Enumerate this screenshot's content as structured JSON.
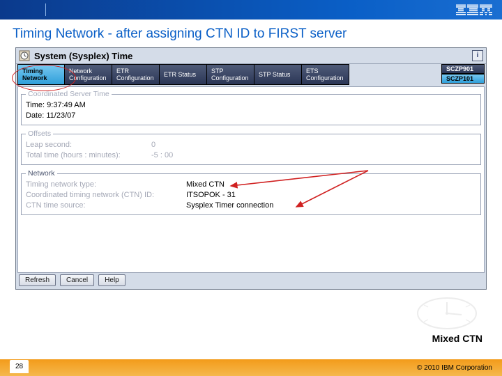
{
  "slide": {
    "title": "Timing Network - after assigning CTN ID to FIRST server",
    "caption": "Mixed CTN",
    "page_number": "28",
    "copyright": "© 2010 IBM Corporation"
  },
  "window": {
    "title": "System (Sysplex) Time",
    "help": "i"
  },
  "tabs": [
    "Timing Network",
    "Network Configuration",
    "ETR Configuration",
    "ETR Status",
    "STP Configuration",
    "STP Status",
    "ETS Configuration"
  ],
  "servers": {
    "a": "SCZP901",
    "b": "SCZP101"
  },
  "groups": {
    "coord": {
      "legend": "Coordinated Server Time",
      "time_label": "Time:",
      "time_value": "9:37:49 AM",
      "date_label": "Date:",
      "date_value": "11/23/07"
    },
    "offsets": {
      "legend": "Offsets",
      "leap_label": "Leap second:",
      "leap_value": "0",
      "total_label": "Total time (hours : minutes):",
      "total_value": "-5 : 00"
    },
    "network": {
      "legend": "Network",
      "type_label": "Timing network type:",
      "type_value": "Mixed CTN",
      "ctn_label": "Coordinated timing network (CTN) ID:",
      "ctn_value": "ITSOPOK - 31",
      "src_label": "CTN time source:",
      "src_value": "Sysplex Timer connection"
    }
  },
  "buttons": {
    "refresh": "Refresh",
    "cancel": "Cancel",
    "help": "Help"
  }
}
